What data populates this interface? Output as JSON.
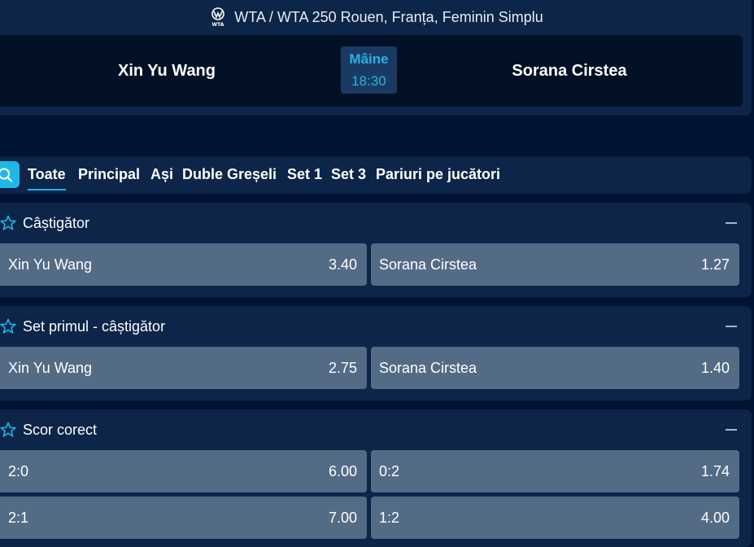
{
  "header": {
    "league": "WTA / WTA 250 Rouen, Franța, Feminin Simplu",
    "league_icon": "wta-logo-icon",
    "home_player": "Xin Yu Wang",
    "away_player": "Sorana Cirstea",
    "day": "Mâine",
    "time": "18:30"
  },
  "tabs": [
    "Toate",
    "Principal",
    "Ași",
    "Duble Greșeli",
    "Set 1",
    "Set 3",
    "Pariuri pe jucători"
  ],
  "active_tab": "Toate",
  "markets": [
    {
      "title": "Câștigător",
      "rows": [
        [
          {
            "label": "Xin Yu Wang",
            "odd": "3.40"
          },
          {
            "label": "Sorana Cirstea",
            "odd": "1.27"
          }
        ]
      ]
    },
    {
      "title": "Set primul - câștigător",
      "rows": [
        [
          {
            "label": "Xin Yu Wang",
            "odd": "2.75"
          },
          {
            "label": "Sorana Cirstea",
            "odd": "1.40"
          }
        ]
      ]
    },
    {
      "title": "Scor corect",
      "rows": [
        [
          {
            "label": "2:0",
            "odd": "6.00"
          },
          {
            "label": "0:2",
            "odd": "1.74"
          }
        ],
        [
          {
            "label": "2:1",
            "odd": "7.00"
          },
          {
            "label": "1:2",
            "odd": "4.00"
          }
        ]
      ]
    }
  ],
  "colors": {
    "page_bg": "#001333",
    "panel_bg": "#0c2548",
    "card_bg": "#031126",
    "odd_bg": "#546b85",
    "accent": "#1fb7e8"
  }
}
